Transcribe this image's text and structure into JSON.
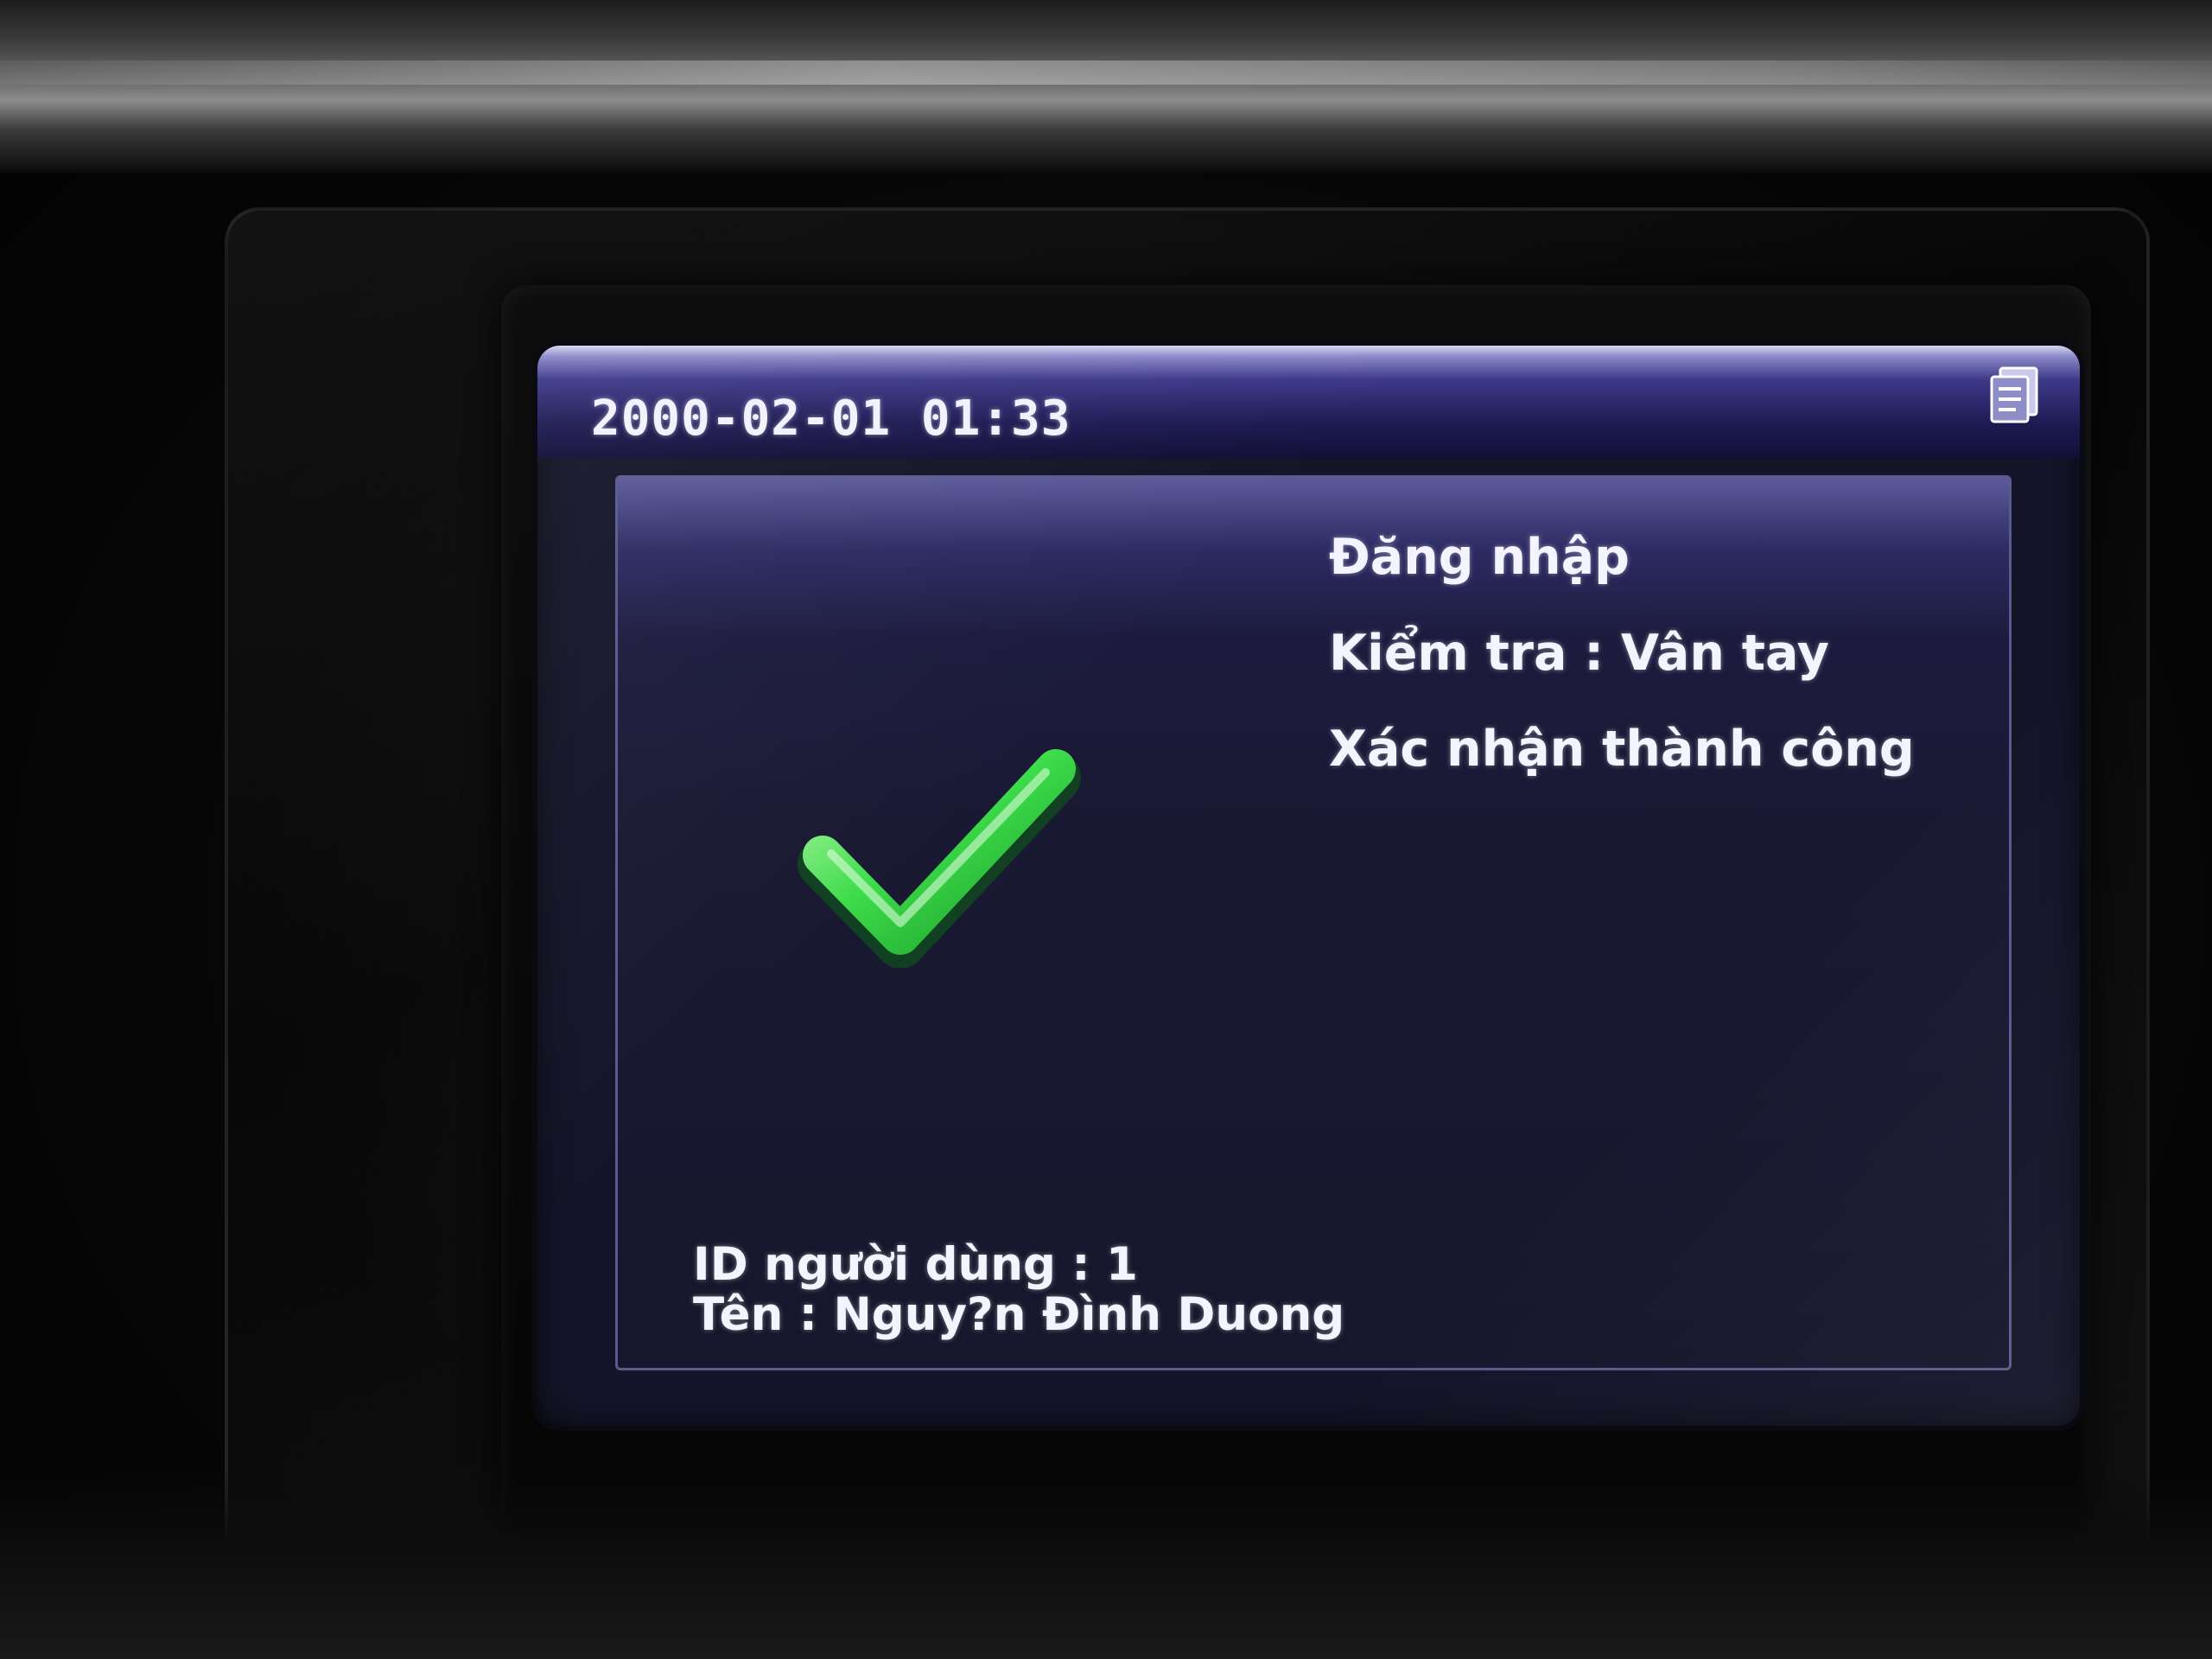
{
  "header": {
    "datetime": "2000-02-01 01:33",
    "icon": "document-icon"
  },
  "result": {
    "icon": "checkmark-icon",
    "icon_color": "#3ddc4a",
    "lines": [
      "Đăng nhập",
      "Kiểm tra : Vân tay",
      "Xác nhận thành công"
    ]
  },
  "user": {
    "id_line": "ID người dùng : 1",
    "name_line": "Tên : Nguy?n Đình Duong"
  },
  "colors": {
    "screen_bg": "#15152a",
    "text": "#f4f4ff",
    "header_accent": "#3e3a8a"
  }
}
